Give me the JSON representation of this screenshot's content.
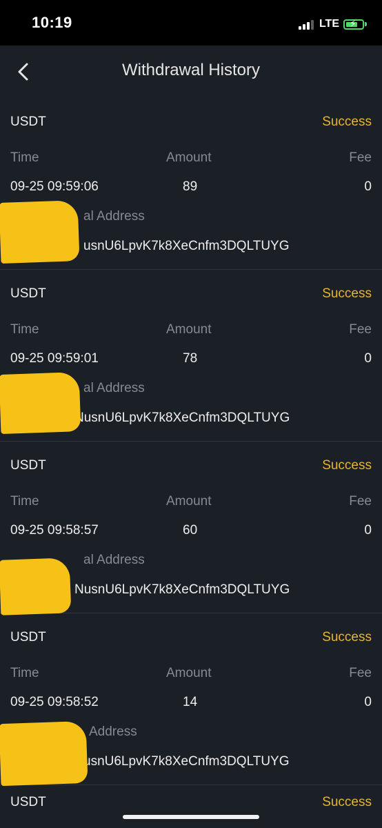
{
  "status_bar": {
    "time": "10:19",
    "network": "LTE",
    "signal_bars_active": 3,
    "signal_bars_total": 4,
    "battery_level": 0.62,
    "battery_charging": true
  },
  "header": {
    "title": "Withdrawal History",
    "back_icon": "chevron-left-icon"
  },
  "labels": {
    "time": "Time",
    "amount": "Amount",
    "fee": "Fee",
    "address": "Withdrawal Address"
  },
  "records": [
    {
      "currency": "USDT",
      "status": "Success",
      "time": "09-25 09:59:06",
      "amount": "89",
      "fee": "0",
      "address_label_visible": "al Address",
      "address_visible": "usnU6LpvK7k8XeCnfm3DQLTUYG"
    },
    {
      "currency": "USDT",
      "status": "Success",
      "time": "09-25 09:59:01",
      "amount": "78",
      "fee": "0",
      "address_label_visible": "al Address",
      "address_visible": "NusnU6LpvK7k8XeCnfm3DQLTUYG"
    },
    {
      "currency": "USDT",
      "status": "Success",
      "time": "09-25 09:58:57",
      "amount": "60",
      "fee": "0",
      "address_label_visible": "al Address",
      "address_visible": "NusnU6LpvK7k8XeCnfm3DQLTUYG"
    },
    {
      "currency": "USDT",
      "status": "Success",
      "time": "09-25 09:58:52",
      "amount": "14",
      "fee": "0",
      "address_label_visible": "Address",
      "address_visible": "usnU6LpvK7k8XeCnfm3DQLTUYG"
    },
    {
      "currency": "USDT",
      "status": "Success"
    }
  ],
  "colors": {
    "background": "#1b1f26",
    "status_success": "#e8b52c",
    "label_gray": "#858a93",
    "redaction_yellow": "#f6c218"
  }
}
